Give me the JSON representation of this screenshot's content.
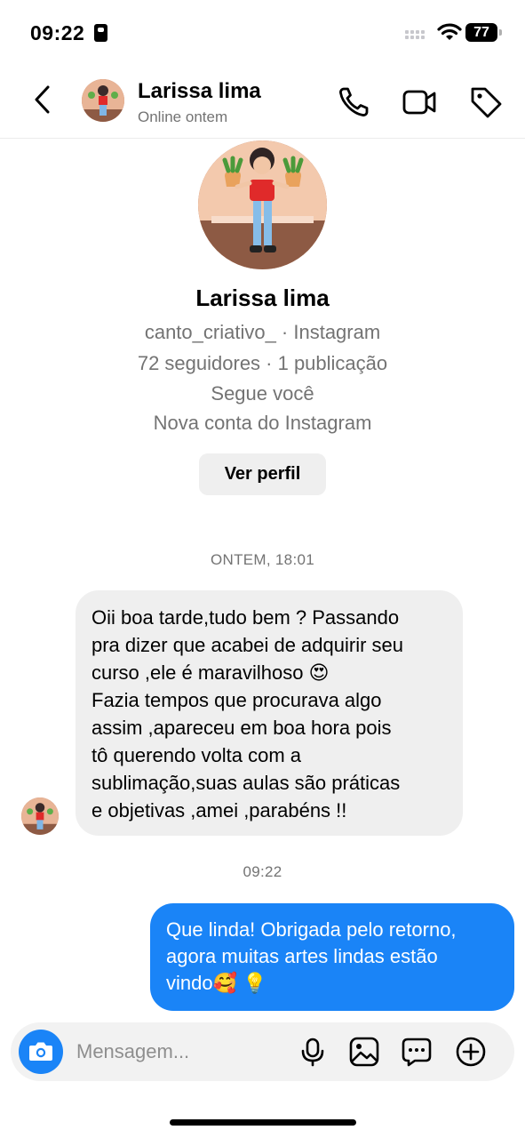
{
  "status_bar": {
    "time": "09:22",
    "battery": "77"
  },
  "header": {
    "name": "Larissa lima",
    "status": "Online ontem"
  },
  "profile": {
    "name": "Larissa lima",
    "handle": "canto_criativo_ · Instagram",
    "followers": "72 seguidores · 1 publicação",
    "follows": "Segue você",
    "account_note": "Nova conta do Instagram",
    "view_button": "Ver perfil"
  },
  "messages": {
    "timestamp_1": "ONTEM, 18:01",
    "incoming_lines": [
      "Oii boa tarde,tudo bem ? Passando",
      "pra dizer que acabei de adquirir seu",
      "curso ,ele é maravilhoso 😍",
      "Fazia tempos que procurava algo",
      "assim ,apareceu em boa hora pois",
      "tô querendo volta com a",
      "sublimação,suas aulas são práticas",
      "e objetivas ,amei ,parabéns !!"
    ],
    "timestamp_2": "09:22",
    "outgoing_lines": [
      "Que linda! Obrigada pelo retorno,",
      "agora muitas artes lindas estão",
      "vindo🥰 💡"
    ]
  },
  "composer": {
    "placeholder": "Mensagem..."
  },
  "colors": {
    "accent": "#1a84f7",
    "bubble_in": "#efefef",
    "muted_text": "#737373"
  },
  "icons": [
    "back-icon",
    "phone-icon",
    "video-camera-icon",
    "tag-icon",
    "camera-icon",
    "microphone-icon",
    "gallery-icon",
    "sticker-icon",
    "plus-icon"
  ]
}
